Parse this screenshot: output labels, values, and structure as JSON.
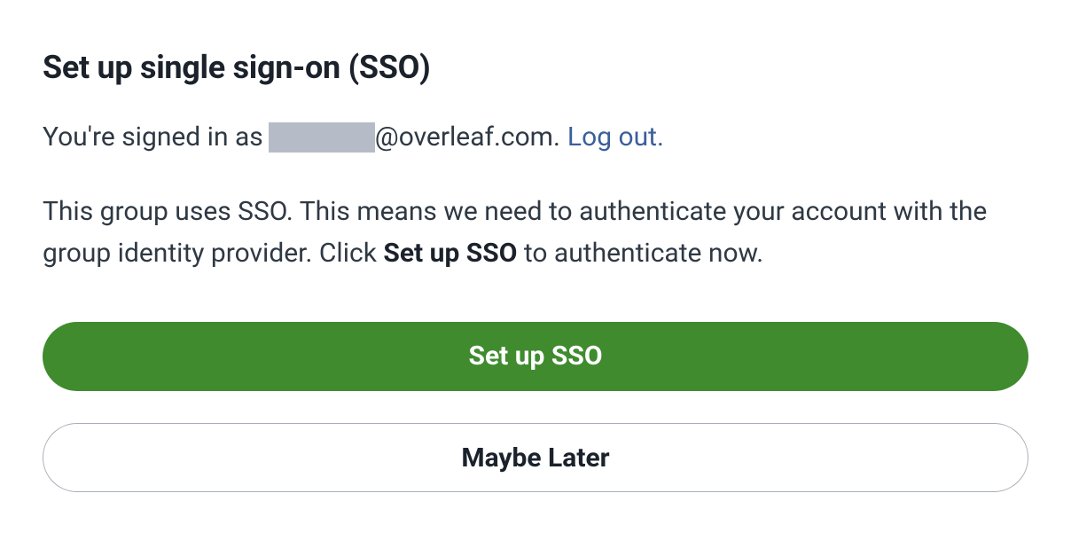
{
  "heading": "Set up single sign-on (SSO)",
  "signed_in": {
    "prefix": "You're signed in as",
    "domain": "@overleaf.com",
    "punctuation": ".",
    "logout_label": "Log out."
  },
  "description": {
    "part1": "This group uses SSO. This means we need to authenticate your account with the group identity provider. Click ",
    "bold": "Set up SSO",
    "part2": " to authenticate now."
  },
  "buttons": {
    "primary": "Set up SSO",
    "secondary": "Maybe Later"
  },
  "colors": {
    "primary_button": "#3f8b2e",
    "link": "#3a5f9b",
    "text": "#1b222c",
    "redacted": "#b6bcc7"
  }
}
